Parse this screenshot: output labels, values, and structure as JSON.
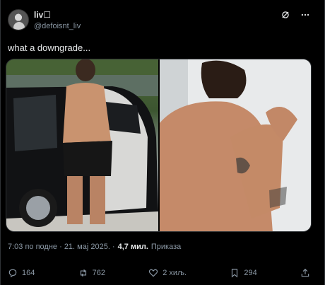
{
  "author": {
    "display_name": "liv",
    "name_emoji": "☐",
    "handle": "@defoisnt_liv"
  },
  "tweet": {
    "text": "what a downgrade..."
  },
  "meta": {
    "time_date": "7:03 по подне · 21. мај 2025. ·",
    "views_count": "4,7 мил.",
    "views_label": "Приказа"
  },
  "actions": {
    "replies": "164",
    "reposts": "762",
    "likes": "2 хиљ.",
    "bookmarks": "294"
  },
  "colors": {
    "background": "#000000",
    "text": "#e7e9ea",
    "secondary": "#8b98a5"
  }
}
